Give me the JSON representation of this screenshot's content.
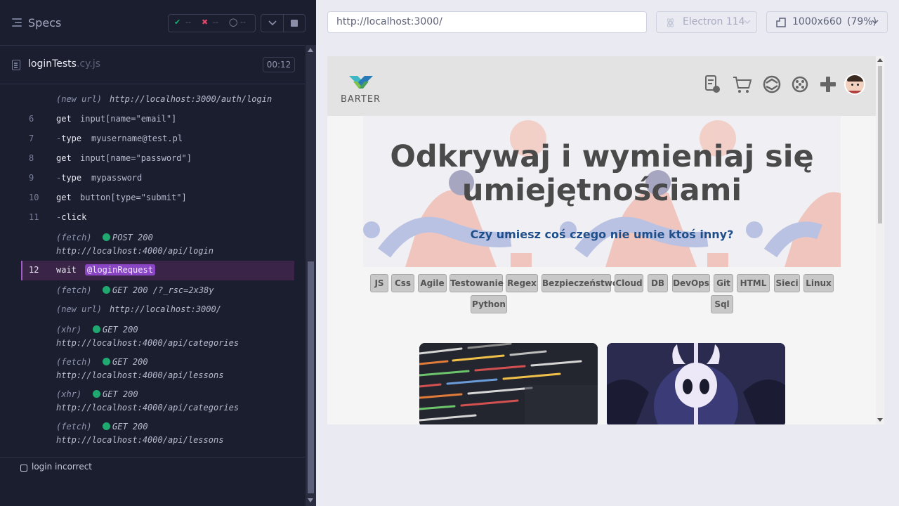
{
  "reporter": {
    "specs_title": "Specs",
    "stats": {
      "passed": "--",
      "failed": "--",
      "pending": "--"
    },
    "spec_file": {
      "name": "loginTests",
      "ext": ".cy.js"
    },
    "timer": "00:12",
    "commands": [
      {
        "kind": "event",
        "name": "(new url)",
        "msg": "http://localhost:3000/auth/login"
      },
      {
        "kind": "cmd",
        "num": "6",
        "name": "get",
        "msg": "input[name=\"email\"]"
      },
      {
        "kind": "child",
        "num": "7",
        "name": "type",
        "msg": "myusername@test.pl"
      },
      {
        "kind": "cmd",
        "num": "8",
        "name": "get",
        "msg": "input[name=\"password\"]"
      },
      {
        "kind": "child",
        "num": "9",
        "name": "type",
        "msg": "mypassword"
      },
      {
        "kind": "cmd",
        "num": "10",
        "name": "get",
        "msg": "button[type=\"submit\"]"
      },
      {
        "kind": "child",
        "num": "11",
        "name": "click",
        "msg": ""
      },
      {
        "kind": "event",
        "name": "(fetch)",
        "status": "POST 200",
        "url": "http://localhost:4000/api/login"
      },
      {
        "kind": "cmd",
        "num": "12",
        "name": "wait",
        "msg": "@loginRequest"
      },
      {
        "kind": "event",
        "name": "(fetch)",
        "status": "GET 200 /?_rsc=2x38y"
      },
      {
        "kind": "event",
        "name": "(new url)",
        "msg": "http://localhost:3000/"
      },
      {
        "kind": "event",
        "name": "(xhr)",
        "status": "GET 200",
        "url": "http://localhost:4000/api/categories"
      },
      {
        "kind": "event",
        "name": "(fetch)",
        "status": "GET 200",
        "url": "http://localhost:4000/api/lessons"
      },
      {
        "kind": "event",
        "name": "(xhr)",
        "status": "GET 200",
        "url": "http://localhost:4000/api/categories"
      },
      {
        "kind": "event",
        "name": "(fetch)",
        "status": "GET 200",
        "url": "http://localhost:4000/api/lessons"
      }
    ],
    "test_title": "login incorrect"
  },
  "aut": {
    "url": "http://localhost:3000/",
    "browser": "Electron 114",
    "viewport": "1000x660",
    "zoom": "(79%)",
    "brand": "BARTER",
    "hero_title": "Odkrywaj i wymieniaj się umiejętnościami",
    "hero_sub": "Czy umiesz coś czego nie umie ktoś inny?",
    "tags": [
      "JS",
      "Css",
      "Agile",
      "Testowanie",
      "Regex",
      "Bezpieczeństwo",
      "Cloud",
      "DB",
      "DevOps",
      "Git",
      "HTML",
      "Sieci",
      "Linux",
      "Python",
      "Sql"
    ],
    "nav_icons": [
      "lessons-icon",
      "cart-icon",
      "exchange-icon",
      "categories-icon",
      "add-icon",
      "user-avatar"
    ]
  },
  "colors": {
    "accent_purple": "#8a45c5",
    "status_green": "#1fa971",
    "hero_sub": "#1f4f8a"
  }
}
